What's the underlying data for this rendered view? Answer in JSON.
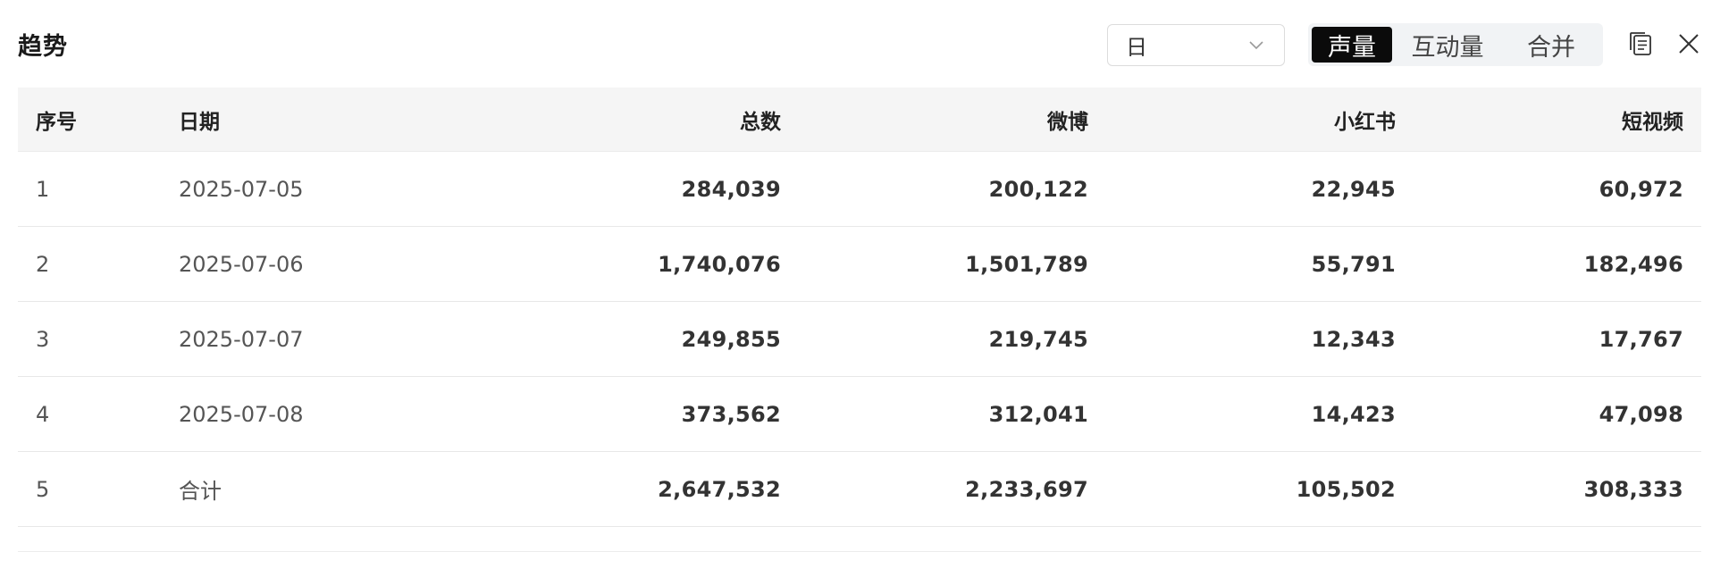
{
  "header": {
    "title": "趋势",
    "period_select": {
      "value": "日"
    },
    "segments": [
      {
        "label": "声量",
        "active": true
      },
      {
        "label": "互动量",
        "active": false
      },
      {
        "label": "合并",
        "active": false
      }
    ],
    "icons": {
      "copy": "copy-icon",
      "close": "close-icon"
    }
  },
  "table": {
    "columns": [
      "序号",
      "日期",
      "总数",
      "微博",
      "小红书",
      "短视频"
    ],
    "rows": [
      {
        "idx": "1",
        "date": "2025-07-05",
        "total": "284,039",
        "weibo": "200,122",
        "xhs": "22,945",
        "video": "60,972"
      },
      {
        "idx": "2",
        "date": "2025-07-06",
        "total": "1,740,076",
        "weibo": "1,501,789",
        "xhs": "55,791",
        "video": "182,496"
      },
      {
        "idx": "3",
        "date": "2025-07-07",
        "total": "249,855",
        "weibo": "219,745",
        "xhs": "12,343",
        "video": "17,767"
      },
      {
        "idx": "4",
        "date": "2025-07-08",
        "total": "373,562",
        "weibo": "312,041",
        "xhs": "14,423",
        "video": "47,098"
      },
      {
        "idx": "5",
        "date": "合计",
        "total": "2,647,532",
        "weibo": "2,233,697",
        "xhs": "105,502",
        "video": "308,333"
      }
    ]
  },
  "colors": {
    "active_segment_bg": "#0b0b0b",
    "segment_bg": "#f1f3f5",
    "header_row_bg": "#f5f5f5"
  }
}
